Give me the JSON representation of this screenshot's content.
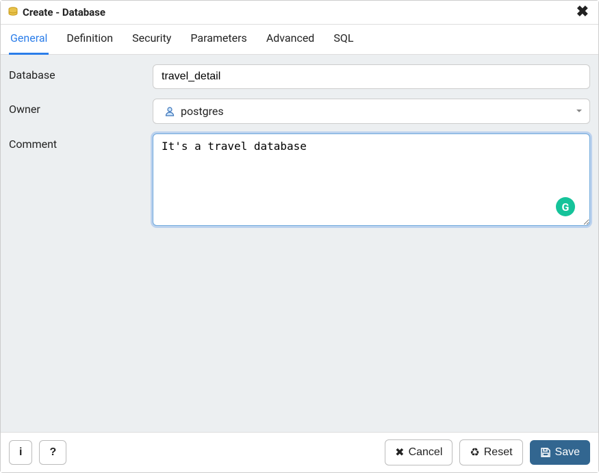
{
  "dialog": {
    "title": "Create - Database"
  },
  "tabs": [
    {
      "label": "General",
      "active": true
    },
    {
      "label": "Definition",
      "active": false
    },
    {
      "label": "Security",
      "active": false
    },
    {
      "label": "Parameters",
      "active": false
    },
    {
      "label": "Advanced",
      "active": false
    },
    {
      "label": "SQL",
      "active": false
    }
  ],
  "form": {
    "database": {
      "label": "Database",
      "value": "travel_detail"
    },
    "owner": {
      "label": "Owner",
      "value": "postgres"
    },
    "comment": {
      "label": "Comment",
      "value": "It's a travel database"
    }
  },
  "footer": {
    "info": "i",
    "help": "?",
    "cancel": "Cancel",
    "reset": "Reset",
    "save": "Save"
  },
  "colors": {
    "accent": "#2b7de9",
    "primaryButton": "#326690",
    "bodyBg": "#eceff1",
    "grammarly": "#15c39a"
  }
}
